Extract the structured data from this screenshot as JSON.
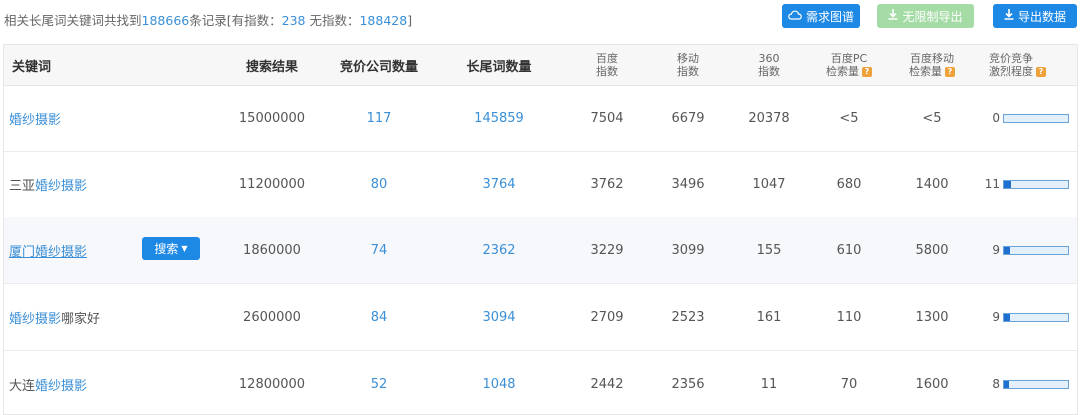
{
  "summary": {
    "prefix": "相关长尾词关键词共找到",
    "total": "188666",
    "mid": "条记录[有指数：",
    "with_index": "238",
    "no_index_label": " 无指数：",
    "no_index": "188428",
    "suffix": "]"
  },
  "buttons": {
    "demand_map": "需求图谱",
    "unlimited_export": "无限制导出",
    "export_data": "导出数据"
  },
  "headers": {
    "keyword": "关键词",
    "search_results": "搜索结果",
    "bid_companies": "竞价公司数量",
    "longtail_count": "长尾词数量",
    "baidu_index_l1": "百度",
    "baidu_index_l2": "指数",
    "mobile_index_l1": "移动",
    "mobile_index_l2": "指数",
    "index360_l1": "360",
    "index360_l2": "指数",
    "pc_volume_l1": "百度PC",
    "pc_volume_l2": "检索量",
    "mobile_volume_l1": "百度移动",
    "mobile_volume_l2": "检索量",
    "competition_l1": "竞价竞争",
    "competition_l2": "激烈程度",
    "help_mark": "?"
  },
  "search_button": "搜索",
  "rows": [
    {
      "kw_pre": "",
      "kw_link": "婚纱摄影",
      "kw_post": "",
      "results": "15000000",
      "companies": "117",
      "longtail": "145859",
      "baidu": "7504",
      "mobile": "6679",
      "i360": "20378",
      "pc": "<5",
      "mob": "<5",
      "comp": "0",
      "comp_level": 0
    },
    {
      "kw_pre": "三亚",
      "kw_link": "婚纱摄影",
      "kw_post": "",
      "results": "11200000",
      "companies": "80",
      "longtail": "3764",
      "baidu": "3762",
      "mobile": "3496",
      "i360": "1047",
      "pc": "680",
      "mob": "1400",
      "comp": "11",
      "comp_level": 0.11
    },
    {
      "kw_pre": "",
      "kw_link": "厦门婚纱摄影",
      "kw_post": "",
      "results": "1860000",
      "companies": "74",
      "longtail": "2362",
      "baidu": "3229",
      "mobile": "3099",
      "i360": "155",
      "pc": "610",
      "mob": "5800",
      "comp": "9",
      "comp_level": 0.09
    },
    {
      "kw_pre": "",
      "kw_link": "婚纱摄影",
      "kw_post": "哪家好",
      "results": "2600000",
      "companies": "84",
      "longtail": "3094",
      "baidu": "2709",
      "mobile": "2523",
      "i360": "161",
      "pc": "110",
      "mob": "1300",
      "comp": "9",
      "comp_level": 0.09
    },
    {
      "kw_pre": "大连",
      "kw_link": "婚纱摄影",
      "kw_post": "",
      "results": "12800000",
      "companies": "52",
      "longtail": "1048",
      "baidu": "2442",
      "mobile": "2356",
      "i360": "11",
      "pc": "70",
      "mob": "1600",
      "comp": "8",
      "comp_level": 0.08
    }
  ],
  "colors": {
    "accent": "#1e88e5",
    "link": "#3b8fd6",
    "disabled_green": "#a5dca5",
    "help": "#f0a23a"
  }
}
